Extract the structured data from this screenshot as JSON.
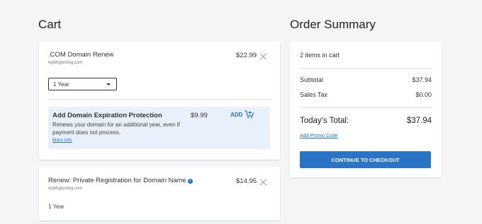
{
  "cart": {
    "title": "Cart",
    "items": [
      {
        "name": ".COM Domain Renew",
        "domain": "wpbhgtesting.com",
        "price": "$22.99",
        "term": "1 Year"
      },
      {
        "name": "Renew: Private Registration for Domain Name",
        "domain": "wpbhgtesting.com",
        "price": "$14.95",
        "term": "1 Year"
      }
    ],
    "protection": {
      "title": "Add Domain Expiration Protection",
      "description": "Renews your domain for an additional year, even if payment does not process.",
      "more_info": "More Info",
      "price": "$9.99",
      "add_label": "ADD"
    }
  },
  "summary": {
    "title": "Order Summary",
    "items_count": "2 items in cart",
    "subtotal_label": "Subtotal",
    "subtotal_value": "$37.94",
    "tax_label": "Sales Tax",
    "tax_value": "$0.00",
    "total_label": "Today's Total:",
    "total_value": "$37.94",
    "promo_link": "Add Promo Code",
    "checkout_label": "CONTINUE TO CHECKOUT"
  },
  "colors": {
    "accent": "#2a74c6",
    "link": "#1f6fc2",
    "protect_bg": "#e8f1fb",
    "page_bg": "#f4f5f7"
  },
  "icons": [
    "close-icon",
    "chevron-down-icon",
    "cart-add-icon",
    "info-icon"
  ]
}
